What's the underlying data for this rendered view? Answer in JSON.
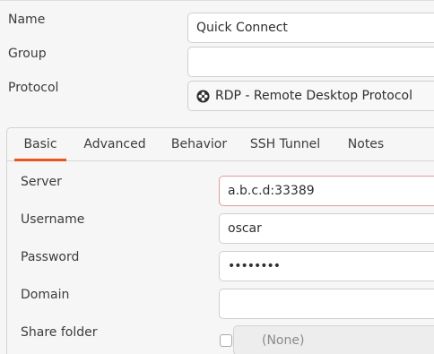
{
  "form": {
    "name_label": "Name",
    "name_value": "Quick Connect",
    "group_label": "Group",
    "group_value": "",
    "protocol_label": "Protocol",
    "protocol_value": "RDP - Remote Desktop Protocol",
    "protocol_icon": "rdp-icon"
  },
  "tabs": [
    {
      "label": "Basic",
      "active": true
    },
    {
      "label": "Advanced",
      "active": false
    },
    {
      "label": "Behavior",
      "active": false
    },
    {
      "label": "SSH Tunnel",
      "active": false
    },
    {
      "label": "Notes",
      "active": false
    }
  ],
  "basic": {
    "server_label": "Server",
    "server_value": "a.b.c.d:33389",
    "username_label": "Username",
    "username_value": "oscar",
    "password_label": "Password",
    "password_value": "••••••••",
    "domain_label": "Domain",
    "domain_value": "",
    "share_folder_label": "Share folder",
    "share_folder_checked": false,
    "share_folder_value": "(None)"
  },
  "colors": {
    "accent": "#e95420",
    "focus_border": "#e39aa0"
  }
}
